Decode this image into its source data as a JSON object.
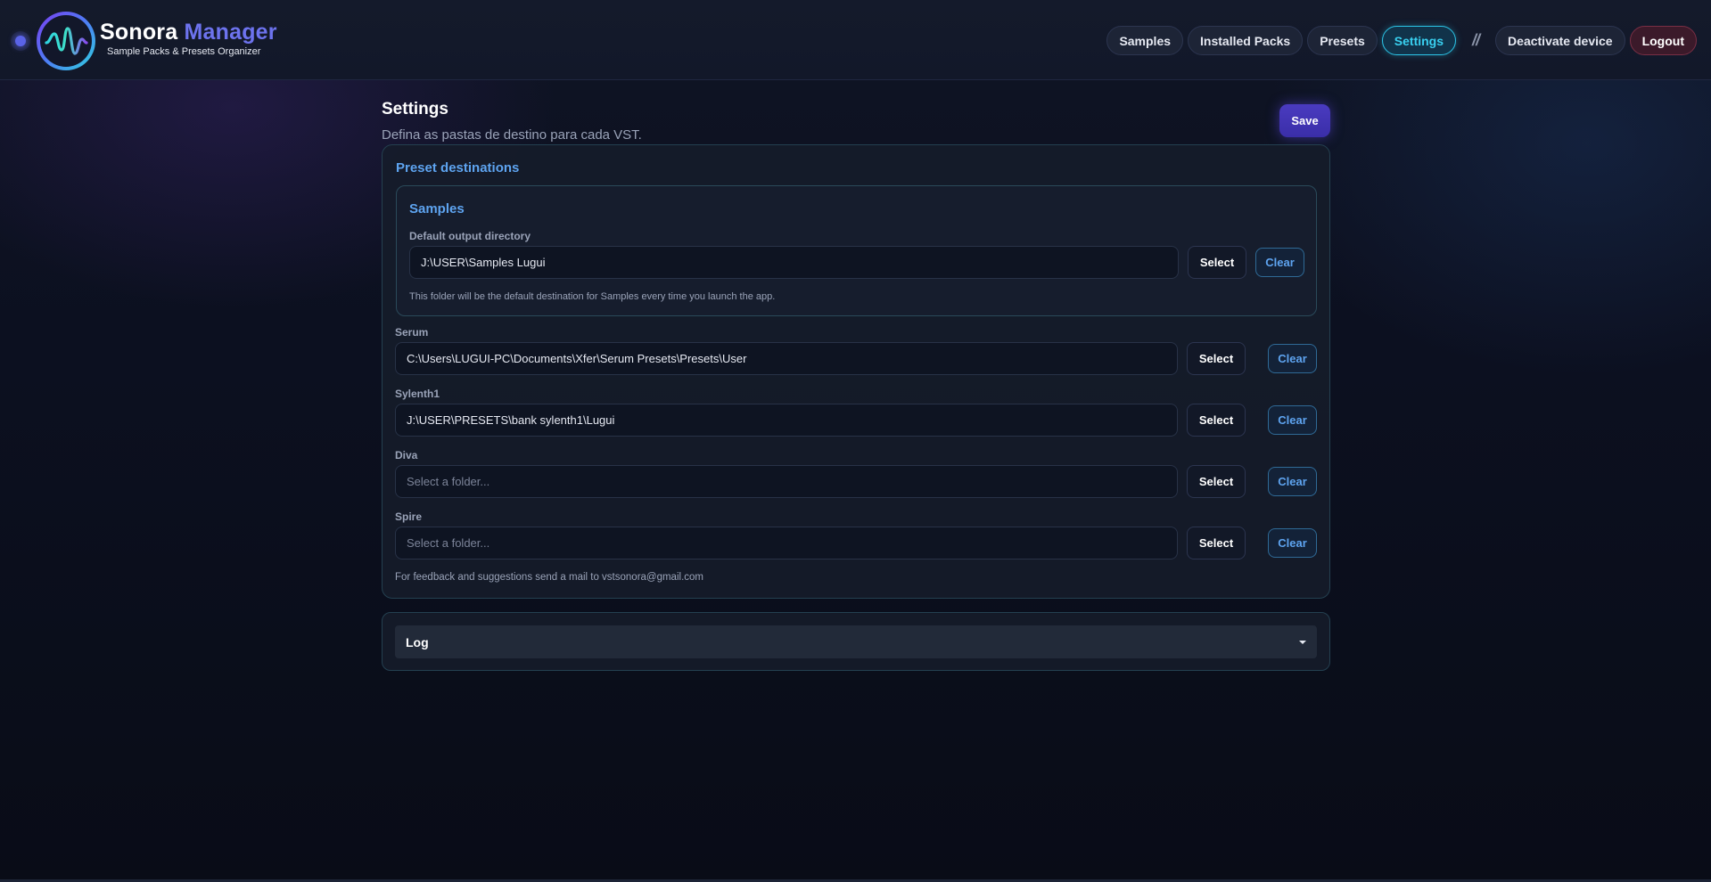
{
  "brand": {
    "title_main": "Sonora",
    "title_accent": "Manager",
    "subtitle": "Sample Packs & Presets Organizer",
    "accent_color": "#6d73ee"
  },
  "nav": {
    "items": [
      {
        "label": "Samples",
        "active": false
      },
      {
        "label": "Installed Packs",
        "active": false
      },
      {
        "label": "Presets",
        "active": false
      },
      {
        "label": "Settings",
        "active": true
      }
    ],
    "separator": "//",
    "deactivate_label": "Deactivate device",
    "logout_label": "Logout"
  },
  "page": {
    "title": "Settings",
    "subtitle": "Defina as pastas de destino para cada VST.",
    "save_label": "Save"
  },
  "preset_destinations": {
    "title": "Preset destinations",
    "samples": {
      "title": "Samples",
      "label": "Default output directory",
      "value": "J:\\USER\\Samples Lugui",
      "hint": "This folder will be the default destination for Samples every time you launch the app."
    },
    "vsts": [
      {
        "name": "Serum",
        "value": "C:\\Users\\LUGUI-PC\\Documents\\Xfer\\Serum Presets\\Presets\\User",
        "placeholder": "Select a folder..."
      },
      {
        "name": "Sylenth1",
        "value": "J:\\USER\\PRESETS\\bank sylenth1\\Lugui",
        "placeholder": "Select a folder..."
      },
      {
        "name": "Diva",
        "value": "",
        "placeholder": "Select a folder..."
      },
      {
        "name": "Spire",
        "value": "",
        "placeholder": "Select a folder..."
      }
    ],
    "select_label": "Select",
    "clear_label": "Clear",
    "feedback": "For feedback and suggestions send a mail to vstsonora@gmail.com"
  },
  "log": {
    "label": "Log"
  },
  "colors": {
    "active_tab": "#39d0f0",
    "link_blue": "#5ea4f0",
    "save_purple": "#4a3bc0",
    "logout_red": "#7a2f45"
  },
  "icons": {
    "status": "status-dot-icon",
    "logo": "waveform-logo-icon",
    "log_toggle": "caret-down-icon"
  }
}
